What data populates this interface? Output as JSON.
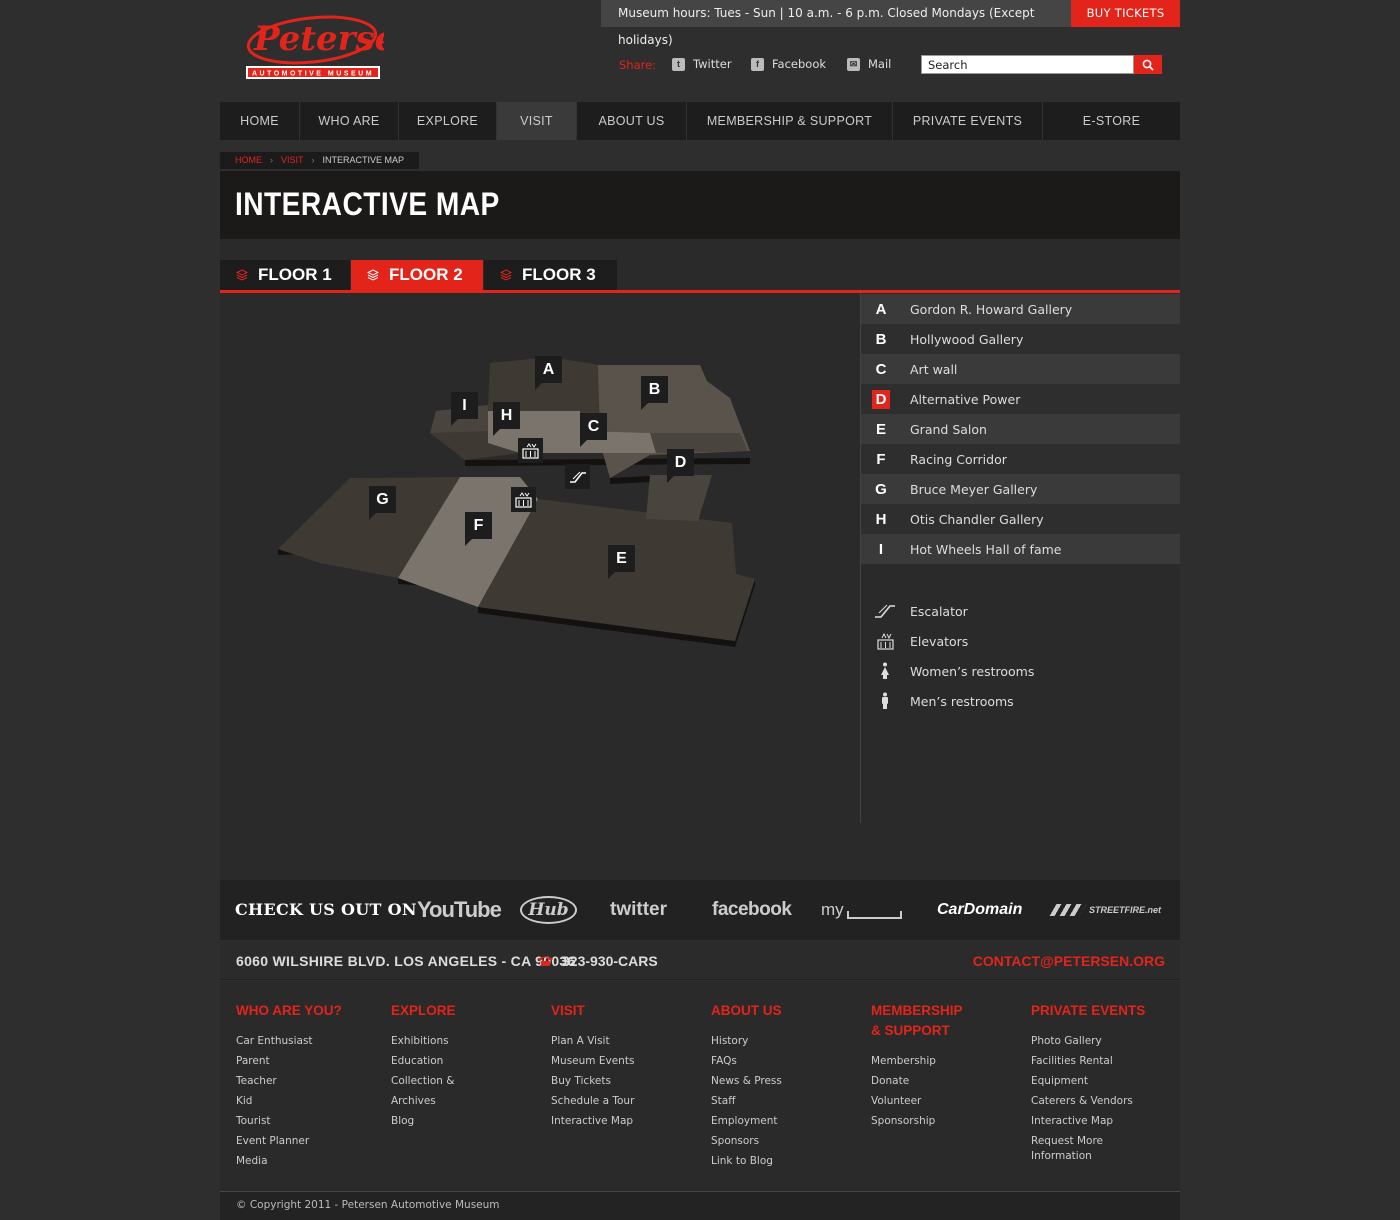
{
  "header": {
    "hours": "Museum hours: Tues - Sun | 10 a.m. - 6 p.m. Closed Mondays (Except holidays)",
    "buy_tickets": "BUY TICKETS",
    "logo_text": "Petersen",
    "logo_sub": "AUTOMOTIVE MUSEUM",
    "share_label": "Share:",
    "share": [
      "Twitter",
      "Facebook",
      "Mail"
    ],
    "search_value": "Search"
  },
  "nav": [
    "HOME",
    "WHO ARE YOU?",
    "EXPLORE",
    "VISIT",
    "ABOUT US",
    "MEMBERSHIP & SUPPORT",
    "PRIVATE EVENTS",
    "E-STORE"
  ],
  "nav_active": "VISIT",
  "breadcrumb": [
    "HOME",
    "VISIT",
    "INTERACTIVE MAP"
  ],
  "page_title": "INTERACTIVE MAP",
  "floor_tabs": [
    "FLOOR 1",
    "FLOOR 2",
    "FLOOR 3"
  ],
  "floor_active": "FLOOR 2",
  "map_markers": [
    "A",
    "B",
    "C",
    "D",
    "E",
    "F",
    "G",
    "H",
    "I"
  ],
  "galleries": [
    {
      "letter": "A",
      "name": "Gordon R. Howard Gallery"
    },
    {
      "letter": "B",
      "name": "Hollywood Gallery"
    },
    {
      "letter": "C",
      "name": "Art wall"
    },
    {
      "letter": "D",
      "name": "Alternative Power"
    },
    {
      "letter": "E",
      "name": "Grand Salon"
    },
    {
      "letter": "F",
      "name": "Racing Corridor"
    },
    {
      "letter": "G",
      "name": "Bruce Meyer Gallery"
    },
    {
      "letter": "H",
      "name": "Otis Chandler Gallery"
    },
    {
      "letter": "I",
      "name": "Hot Wheels Hall of fame"
    }
  ],
  "gallery_active": "D",
  "facilities": [
    {
      "icon": "escalator-icon",
      "name": "Escalator"
    },
    {
      "icon": "elevator-icon",
      "name": "Elevators"
    },
    {
      "icon": "womens-restroom-icon",
      "name": "Women’s restrooms"
    },
    {
      "icon": "mens-restroom-icon",
      "name": "Men’s restrooms"
    }
  ],
  "social": {
    "title": "CHECK US OUT ON",
    "logos": [
      "YouTube",
      "Hub",
      "twitter",
      "facebook",
      "my",
      "CarDomain",
      "STREETFIRE.net"
    ]
  },
  "contact": {
    "address": "6060 WILSHIRE BLVD. LOS ANGELES - CA 90036",
    "phone": "323-930-CARS",
    "email": "CONTACT@PETERSEN.ORG"
  },
  "footer": [
    {
      "title": "WHO ARE YOU?",
      "links": [
        "Car Enthusiast",
        "Parent",
        "Teacher",
        "Kid",
        "Tourist",
        "Event Planner",
        "Media"
      ]
    },
    {
      "title": "EXPLORE",
      "links": [
        "Exhibitions",
        "Education",
        "Collection & Archives",
        "Blog"
      ]
    },
    {
      "title": "VISIT",
      "links": [
        "Plan A Visit",
        "Museum Events",
        "Buy Tickets",
        "Schedule a Tour",
        "Interactive Map"
      ]
    },
    {
      "title": "ABOUT US",
      "links": [
        "History",
        "FAQs",
        "News & Press",
        "Staff",
        "Employment",
        "Sponsors",
        "Link to Blog"
      ]
    },
    {
      "title": "MEMBERSHIP & SUPPORT",
      "links": [
        "Membership",
        "Donate",
        "Volunteer",
        "Sponsorship"
      ]
    },
    {
      "title": "PRIVATE EVENTS",
      "links": [
        "Photo Gallery",
        "Facilities Rental",
        "Equipment",
        "Caterers & Vendors",
        "Interactive Map",
        "Request More Information"
      ]
    }
  ],
  "copyright": "© Copyright 2011 - Petersen Automotive Museum",
  "colors": {
    "accent": "#e3241b",
    "background": "#2e2e2e",
    "nav": "#1d1d1d",
    "map_floor_dark": "#3f3933",
    "map_floor_light": "#7a746d"
  }
}
